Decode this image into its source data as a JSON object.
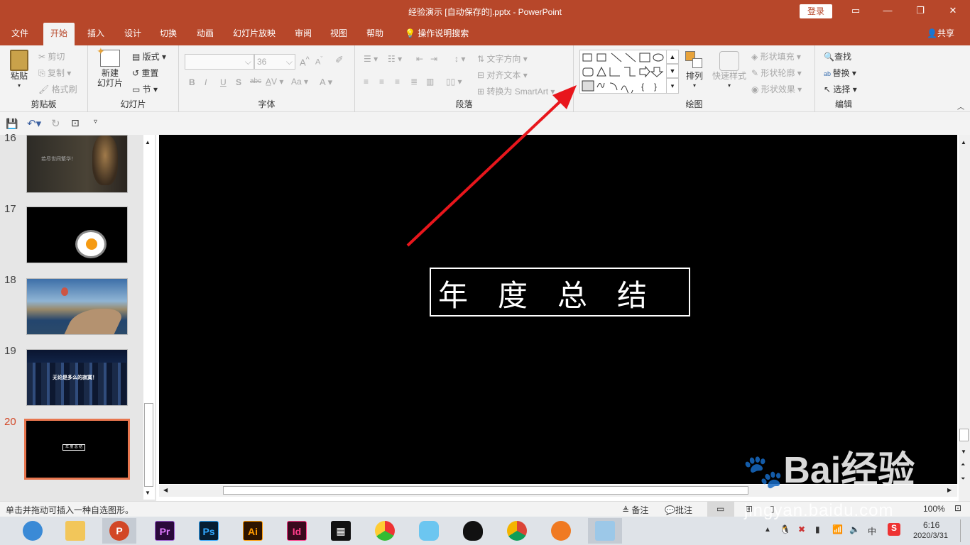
{
  "window": {
    "title": "经验演示 [自动保存的].pptx  -  PowerPoint",
    "login": "登录"
  },
  "tabs": [
    "文件",
    "开始",
    "插入",
    "设计",
    "切换",
    "动画",
    "幻灯片放映",
    "审阅",
    "视图",
    "帮助",
    "操作说明搜索"
  ],
  "share": "共享",
  "ribbon": {
    "clipboard": {
      "paste": "粘贴",
      "cut": "剪切",
      "copy": "复制",
      "format_painter": "格式刷",
      "label": "剪贴板"
    },
    "slides": {
      "new_slide": "新建\n幻灯片",
      "layout": "版式",
      "reset": "重置",
      "section": "节",
      "label": "幻灯片"
    },
    "font": {
      "size": "36",
      "bold": "B",
      "italic": "I",
      "underline": "U",
      "strike": "S",
      "spacing": "abc",
      "label": "字体"
    },
    "paragraph": {
      "text_direction": "文字方向",
      "align_text": "对齐文本",
      "convert_smartart": "转换为 SmartArt",
      "label": "段落"
    },
    "drawing": {
      "arrange": "排列",
      "quick_styles": "快速样式",
      "shape_fill": "形状填充",
      "shape_outline": "形状轮廓",
      "shape_effects": "形状效果",
      "label": "绘图"
    },
    "editing": {
      "find": "查找",
      "replace": "替换",
      "select": "选择",
      "label": "编辑"
    }
  },
  "slides_panel": {
    "numbers": [
      "16",
      "17",
      "18",
      "19",
      "20"
    ],
    "slide16_text": "若尽世间繁华！",
    "slide19_text": "无论是多么的寂寞！",
    "slide20_text": "年 度 总 结"
  },
  "slide": {
    "title": "年　度　总　结"
  },
  "statusbar": {
    "hint": "单击并拖动可插入一种自选图形。",
    "notes": "备注",
    "comments": "批注",
    "zoom": "100%"
  },
  "taskbar": {
    "ps": "Ps",
    "pr": "Pr",
    "ai": "Ai",
    "id": "Id",
    "ime": "中",
    "time": "6:16",
    "date": "2020/3/31"
  },
  "watermark": {
    "brand": "Bai经验",
    "url": "jingyan.baidu.com"
  },
  "colors": {
    "accent": "#b7472a",
    "arrow": "#e8161c"
  }
}
